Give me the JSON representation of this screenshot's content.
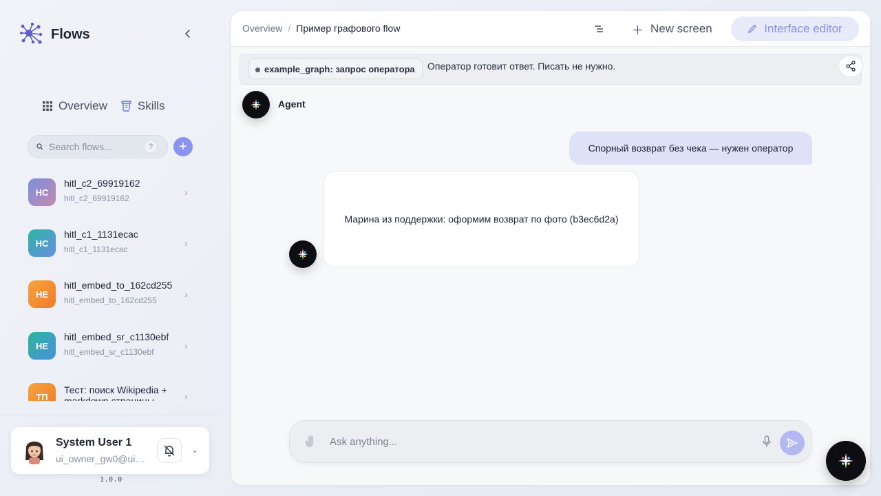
{
  "brand": {
    "title": "Flows",
    "color": "#5b5fc7"
  },
  "nav": [
    {
      "label": "Overview",
      "icon": "grid-icon"
    },
    {
      "label": "Skills",
      "icon": "scroll-icon"
    }
  ],
  "search": {
    "placeholder": "Search flows...",
    "help": "?"
  },
  "add_button": "+",
  "flows": [
    {
      "initials": "HC",
      "title": "hitl_c2_69919162",
      "subtitle": "hitl_c2_69919162",
      "color_from": "#7b8fe0",
      "color_to": "#c48ab0"
    },
    {
      "initials": "HC",
      "title": "hitl_c1_1131ecac",
      "subtitle": "hitl_c1_1131ecac",
      "color_from": "#2bb5a0",
      "color_to": "#6a8ee6"
    },
    {
      "initials": "HE",
      "title": "hitl_embed_to_162cd255",
      "subtitle": "hitl_embed_to_162cd255",
      "color_from": "#f7a43a",
      "color_to": "#f07a2c"
    },
    {
      "initials": "HE",
      "title": "hitl_embed_sr_c1130ebf",
      "subtitle": "hitl_embed_sr_c1130ebf",
      "color_from": "#2bb5a0",
      "color_to": "#4c8fd8"
    },
    {
      "initials": "ТП",
      "title": "Тест: поиск Wikipedia + markdown страницы",
      "subtitle": "",
      "color_from": "#f7a43a",
      "color_to": "#f07a2c"
    }
  ],
  "user": {
    "name": "System User 1",
    "email": "ui_owner_gw0@ui_...",
    "version": "1.0.0"
  },
  "topbar": {
    "breadcrumb_root": "Overview",
    "breadcrumb_sep": "/",
    "breadcrumb_current": "Пример графового flow",
    "new_screen": "New screen",
    "interface_editor": "Interface editor"
  },
  "status": {
    "chip": "example_graph: запрос оператора",
    "text": "Оператор готовит ответ. Писать не нужно."
  },
  "chat": {
    "agent_name": "Agent",
    "messages": [
      {
        "role": "user",
        "text": "Спорный возврат без чека — нужен оператор"
      },
      {
        "role": "agent",
        "text": "Марина из поддержки: оформим возврат по фото (b3ec6d2a)"
      }
    ]
  },
  "composer": {
    "placeholder": "Ask anything..."
  },
  "colors": {
    "accent": "#8b93f0",
    "user_bubble": "#dfe2f7",
    "editor_button": "#e7eaf9"
  }
}
